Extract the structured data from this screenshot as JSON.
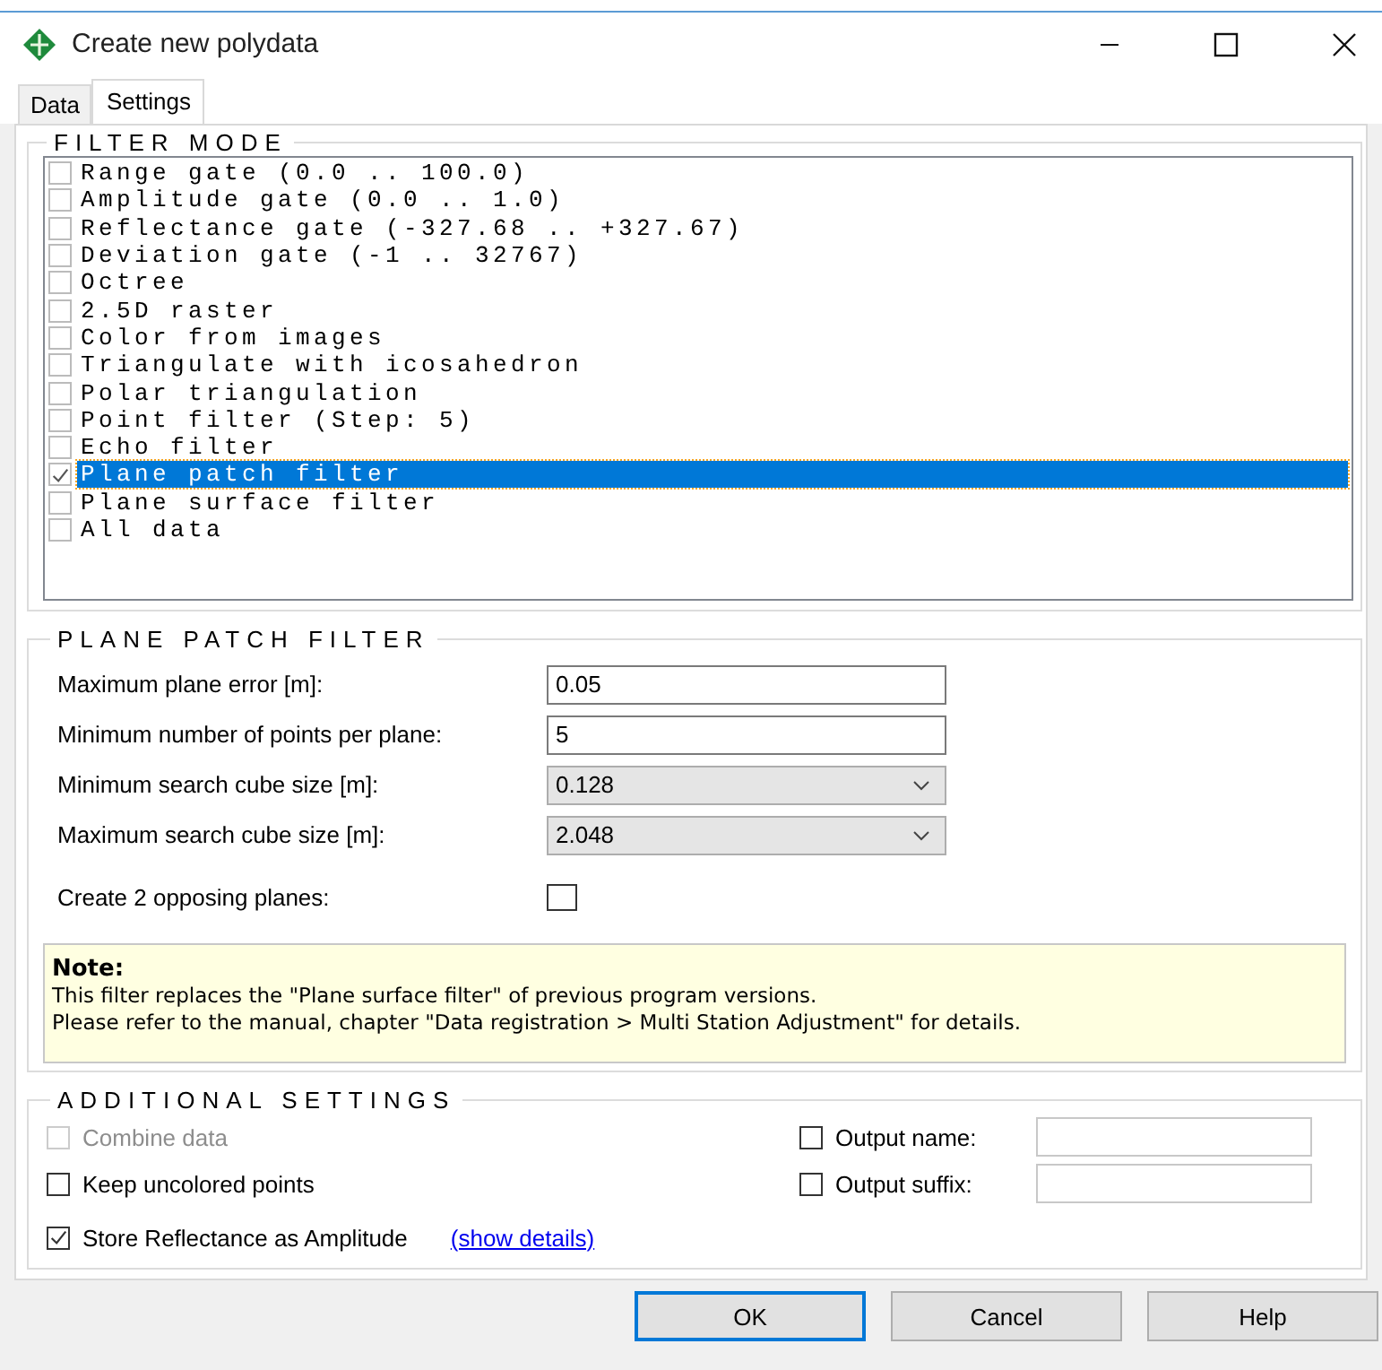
{
  "window": {
    "title": "Create new polydata"
  },
  "tabs": [
    {
      "label": "Data",
      "selected": false
    },
    {
      "label": "Settings",
      "selected": true
    }
  ],
  "filter_mode": {
    "title": "FILTER MODE",
    "items": [
      {
        "label": "Range gate (0.0 .. 100.0)",
        "checked": false,
        "selected": false
      },
      {
        "label": "Amplitude gate (0.0 .. 1.0)",
        "checked": false,
        "selected": false
      },
      {
        "label": "Reflectance gate (-327.68 .. +327.67)",
        "checked": false,
        "selected": false
      },
      {
        "label": "Deviation gate (-1 .. 32767)",
        "checked": false,
        "selected": false
      },
      {
        "label": "Octree",
        "checked": false,
        "selected": false
      },
      {
        "label": "2.5D raster",
        "checked": false,
        "selected": false
      },
      {
        "label": "Color from images",
        "checked": false,
        "selected": false
      },
      {
        "label": "Triangulate with icosahedron",
        "checked": false,
        "selected": false
      },
      {
        "label": "Polar triangulation",
        "checked": false,
        "selected": false
      },
      {
        "label": "Point filter (Step: 5)",
        "checked": false,
        "selected": false
      },
      {
        "label": "Echo filter",
        "checked": false,
        "selected": false
      },
      {
        "label": "Plane patch filter",
        "checked": true,
        "selected": true
      },
      {
        "label": "Plane surface filter",
        "checked": false,
        "selected": false
      },
      {
        "label": "All data",
        "checked": false,
        "selected": false
      }
    ]
  },
  "plane_patch_filter": {
    "title": "PLANE PATCH FILTER",
    "fields": [
      {
        "kind": "text",
        "label": "Maximum plane error [m]:",
        "value": "0.05"
      },
      {
        "kind": "text",
        "label": "Minimum number of points per plane:",
        "value": "5"
      },
      {
        "kind": "dropdown",
        "label": "Minimum search cube size [m]:",
        "value": "0.128"
      },
      {
        "kind": "dropdown",
        "label": "Maximum search cube size [m]:",
        "value": "2.048"
      },
      {
        "kind": "checkbox",
        "label": "Create 2 opposing planes:",
        "checked": false
      }
    ],
    "note": {
      "title": "Note:",
      "lines": [
        "This filter replaces the \"Plane surface filter\" of previous program versions.",
        "Please refer to the manual, chapter \"Data registration > Multi Station Adjustment\" for details."
      ]
    }
  },
  "additional_settings": {
    "title": "ADDITIONAL SETTINGS",
    "left": [
      {
        "label": "Combine data",
        "checked": false,
        "disabled": true
      },
      {
        "label": "Keep uncolored points",
        "checked": false,
        "disabled": false
      },
      {
        "label": "Store Reflectance as Amplitude",
        "checked": true,
        "disabled": false,
        "link": "(show details)"
      }
    ],
    "right": [
      {
        "label": "Output name:",
        "checked": false
      },
      {
        "label": "Output suffix:",
        "checked": false
      }
    ]
  },
  "buttons": [
    {
      "label": "OK",
      "default": true
    },
    {
      "label": "Cancel",
      "default": false
    },
    {
      "label": "Help",
      "default": false
    }
  ]
}
